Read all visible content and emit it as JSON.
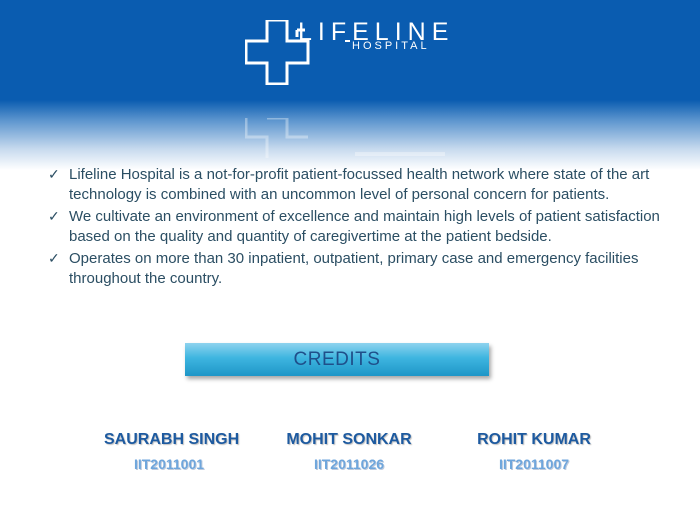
{
  "logo": {
    "line1": "LIFELINE",
    "line2": "HOSPITAL"
  },
  "bullets": [
    {
      "icon": "checkmark-icon",
      "text": "Lifeline Hospital is a not-for-profit patient-focussed health network where state of the art technology is combined with an uncommon level of personal concern for patients."
    },
    {
      "icon": "checkmark-icon",
      "text": "We cultivate an environment of excellence and maintain high levels of patient satisfaction based on the quality and quantity of caregivertime at the patient bedside."
    },
    {
      "icon": "checkmark-icon",
      "text": "Operates on more than 30 inpatient, outpatient, primary case and emergency facilities throughout the country."
    }
  ],
  "credits": {
    "label": "CREDITS"
  },
  "people": [
    {
      "name": "SAURABH SINGH",
      "id": "IIT2011001"
    },
    {
      "name": "MOHIT SONKAR",
      "id": "IIT2011026"
    },
    {
      "name": "ROHIT KUMAR",
      "id": "IIT2011007"
    }
  ],
  "colors": {
    "header": "#0a5cb0",
    "text": "#2b4e63",
    "name": "#1d5aa0",
    "id": "#6fa6dc",
    "button": "#3eb5e0"
  }
}
